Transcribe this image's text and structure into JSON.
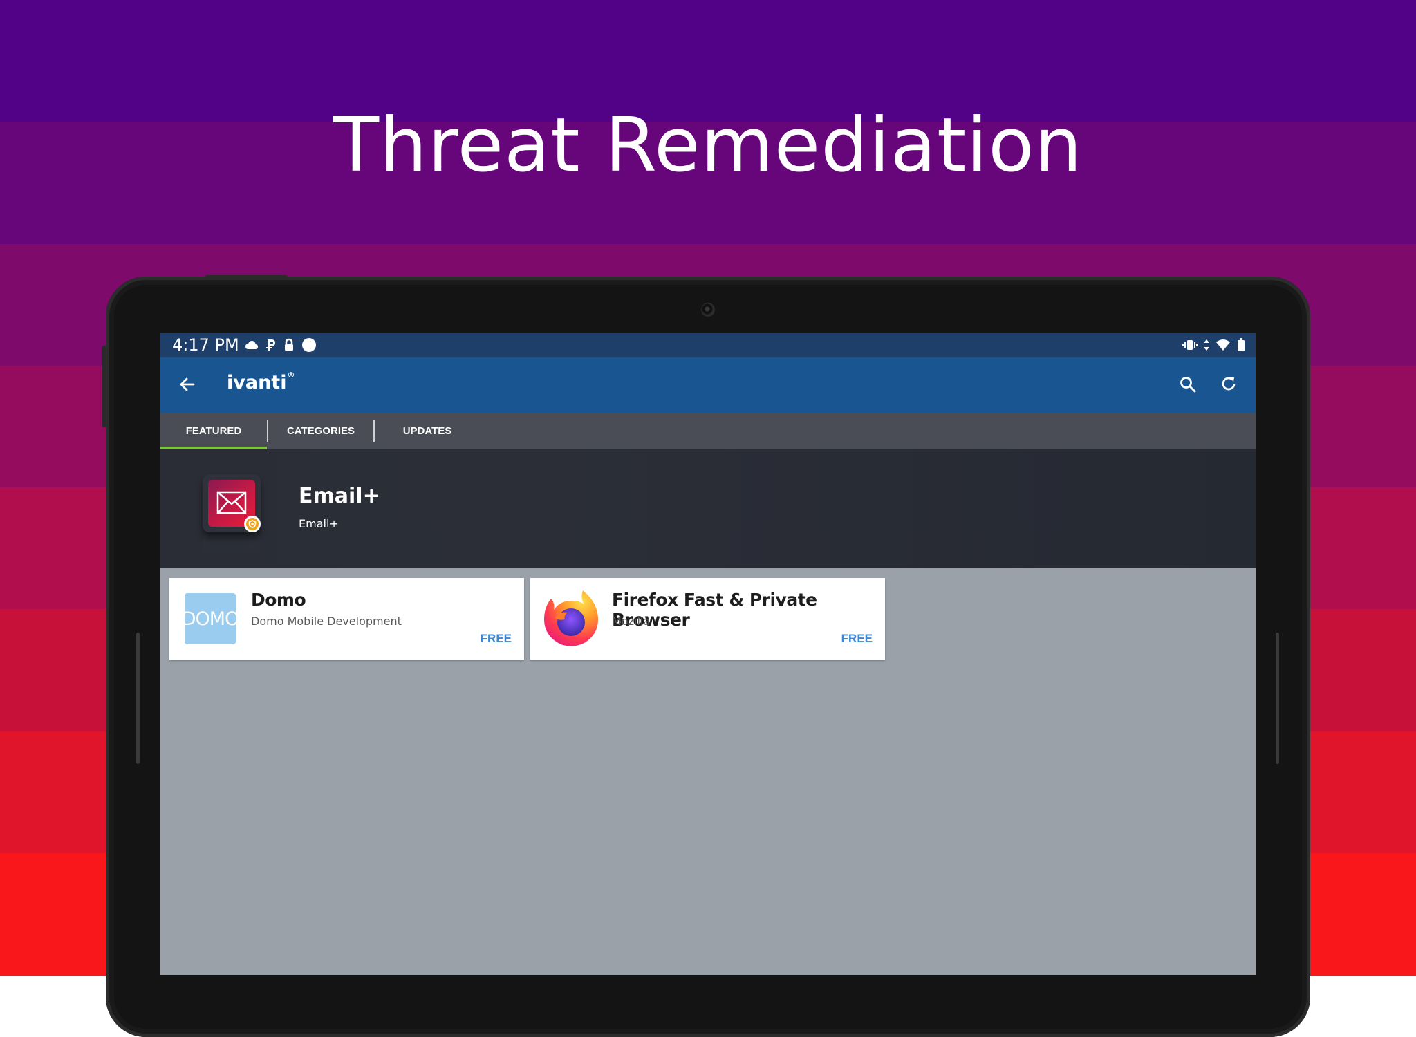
{
  "banner": {
    "headline": "Threat Remediation"
  },
  "colors": {
    "bands": [
      "#520286",
      "#67067a",
      "#7e0a6c",
      "#950c5e",
      "#b00e4d",
      "#c71138",
      "#e0142a",
      "#f9171b"
    ],
    "status_bar": "#1e3f69",
    "app_bar": "#195591",
    "tab_bar": "#4a4d55",
    "tab_indicator": "#7cc243",
    "price": "#3b86d6"
  },
  "status_bar": {
    "time": "4:17 PM",
    "left_icons": [
      "cloud-icon",
      "p-icon",
      "lock-icon",
      "circle-icon"
    ],
    "right_icons": [
      "vibrate-icon",
      "data-arrows-icon",
      "wifi-icon",
      "battery-icon"
    ]
  },
  "app_bar": {
    "logo_text": "ivanti",
    "logo_mark": "®",
    "icons": [
      "back-arrow-icon",
      "search-icon",
      "refresh-icon"
    ]
  },
  "tabs": [
    {
      "label": "FEATURED",
      "active": true
    },
    {
      "label": "CATEGORIES",
      "active": false
    },
    {
      "label": "UPDATES",
      "active": false
    }
  ],
  "featured": {
    "title": "Email+",
    "subtitle": "Email+",
    "icon": "email-plus-icon"
  },
  "apps": [
    {
      "name": "Domo",
      "developer": "Domo Mobile Development",
      "price": "FREE",
      "icon_text": "DOMO",
      "icon": "domo-icon"
    },
    {
      "name": "Firefox Fast & Private Browser",
      "developer": "Mozilla",
      "price": "FREE",
      "icon": "firefox-icon"
    }
  ]
}
